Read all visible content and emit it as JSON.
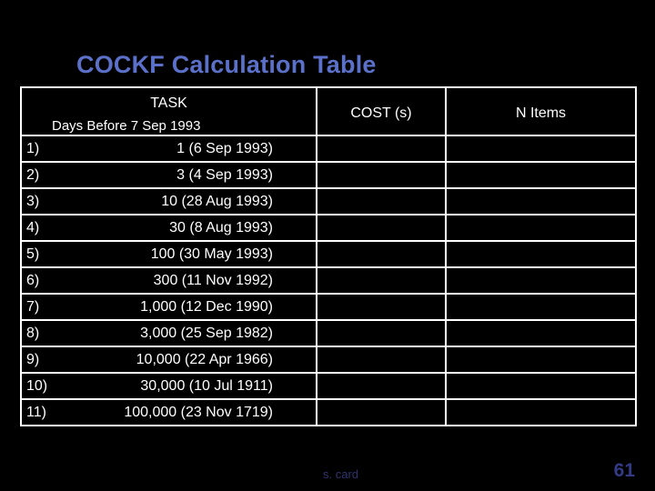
{
  "slide": {
    "title": "COCKF Calculation Table",
    "title_color": "#5b70c9",
    "background_color": "#000000",
    "text_color": "#ffffff"
  },
  "table": {
    "columns": [
      {
        "label": "TASK",
        "sublabel": "Days Before 7 Sep 1993"
      },
      {
        "label": "COST (s)",
        "sublabel": ""
      },
      {
        "label": "N Items",
        "sublabel": ""
      }
    ],
    "rows": [
      {
        "index": "1)",
        "task": "1 (6 Sep 1993)",
        "cost": "",
        "n_items": ""
      },
      {
        "index": "2)",
        "task": "3 (4 Sep 1993)",
        "cost": "",
        "n_items": ""
      },
      {
        "index": "3)",
        "task": "10 (28 Aug 1993)",
        "cost": "",
        "n_items": ""
      },
      {
        "index": "4)",
        "task": "30 (8 Aug 1993)",
        "cost": "",
        "n_items": ""
      },
      {
        "index": "5)",
        "task": "100 (30 May 1993)",
        "cost": "",
        "n_items": ""
      },
      {
        "index": "6)",
        "task": "300 (11 Nov 1992)",
        "cost": "",
        "n_items": ""
      },
      {
        "index": "7)",
        "task": "1,000 (12 Dec 1990)",
        "cost": "",
        "n_items": ""
      },
      {
        "index": "8)",
        "task": "3,000 (25 Sep 1982)",
        "cost": "",
        "n_items": ""
      },
      {
        "index": "9)",
        "task": "10,000 (22 Apr 1966)",
        "cost": "",
        "n_items": ""
      },
      {
        "index": "10)",
        "task": "30,000 (10 Jul 1911)",
        "cost": "",
        "n_items": ""
      },
      {
        "index": "11)",
        "task": "100,000 (23 Nov 1719)",
        "cost": "",
        "n_items": ""
      }
    ]
  },
  "footer": {
    "note": "s. card",
    "note_color": "#2f3470",
    "page_number": "61",
    "page_number_color": "#333a86"
  }
}
